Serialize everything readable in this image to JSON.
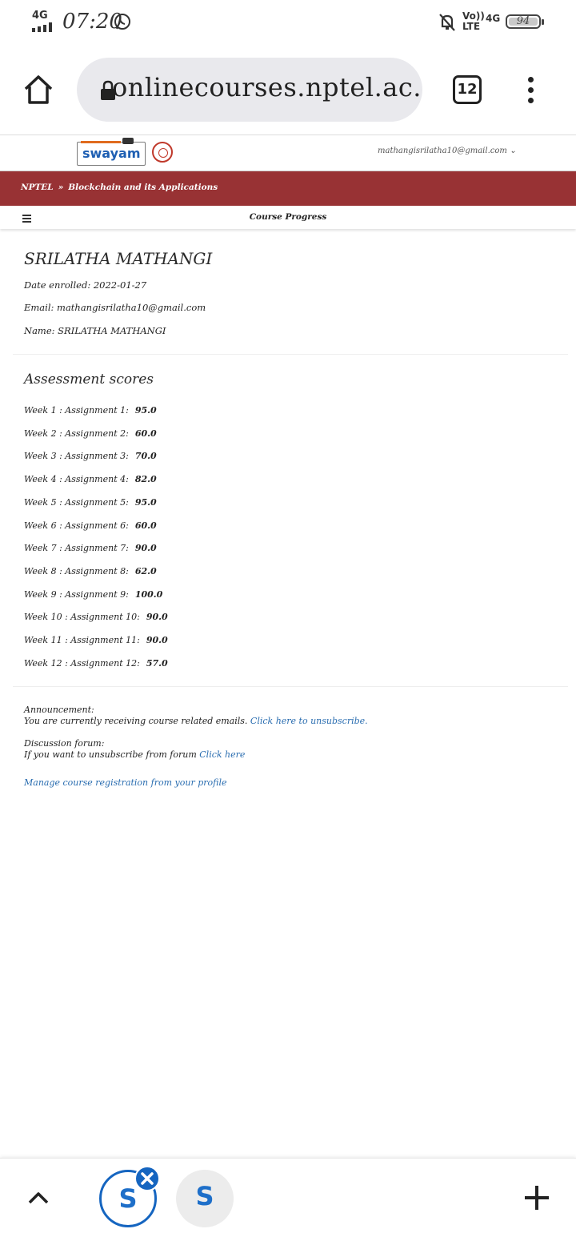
{
  "statusbar": {
    "network": "4G",
    "time": "07:20",
    "volte": "Vo)) LTE",
    "network2": "4G",
    "battery": "94",
    "icons": [
      "signal-icon",
      "whatsapp-icon",
      "mute-icon",
      "battery-icon"
    ]
  },
  "browser": {
    "url": "onlinecourses.nptel.ac.in",
    "tab_count": "12"
  },
  "site": {
    "logo_text": "swayam",
    "user_email": "mathangisrilatha10@gmail.com"
  },
  "breadcrumb": {
    "root": "NPTEL",
    "separator": "»",
    "course": "Blockchain and its Applications"
  },
  "page_title": "Course Progress",
  "learner": {
    "name": "SRILATHA MATHANGI",
    "date_enrolled": "Date enrolled: 2022-01-27",
    "email": "Email: mathangisrilatha10@gmail.com",
    "name_line": "Name: SRILATHA MATHANGI"
  },
  "assessment": {
    "title": "Assessment scores",
    "rows": [
      {
        "label": "Week 1 : Assignment 1:",
        "score": "95.0"
      },
      {
        "label": "Week 2 : Assignment 2:",
        "score": "60.0"
      },
      {
        "label": "Week 3 : Assignment 3:",
        "score": "70.0"
      },
      {
        "label": "Week 4 : Assignment 4:",
        "score": "82.0"
      },
      {
        "label": "Week 5 : Assignment 5:",
        "score": "95.0"
      },
      {
        "label": "Week 6 : Assignment 6:",
        "score": "60.0"
      },
      {
        "label": "Week 7 : Assignment 7:",
        "score": "90.0"
      },
      {
        "label": "Week 8 : Assignment 8:",
        "score": "62.0"
      },
      {
        "label": "Week 9 : Assignment 9:",
        "score": "100.0"
      },
      {
        "label": "Week 10 : Assignment 10:",
        "score": "90.0"
      },
      {
        "label": "Week 11 : Assignment 11:",
        "score": "90.0"
      },
      {
        "label": "Week 12 : Assignment 12:",
        "score": "57.0"
      }
    ]
  },
  "announcement": {
    "label": "Announcement:",
    "text": "You are currently receiving course related emails.",
    "link": "Click here to unsubscribe."
  },
  "forum": {
    "label": "Discussion forum:",
    "text": "If you want to unsubscribe from forum",
    "link": "Click here"
  },
  "manage_link": "Manage course registration from your profile",
  "bottombar": {
    "tab_glyph": "S"
  }
}
